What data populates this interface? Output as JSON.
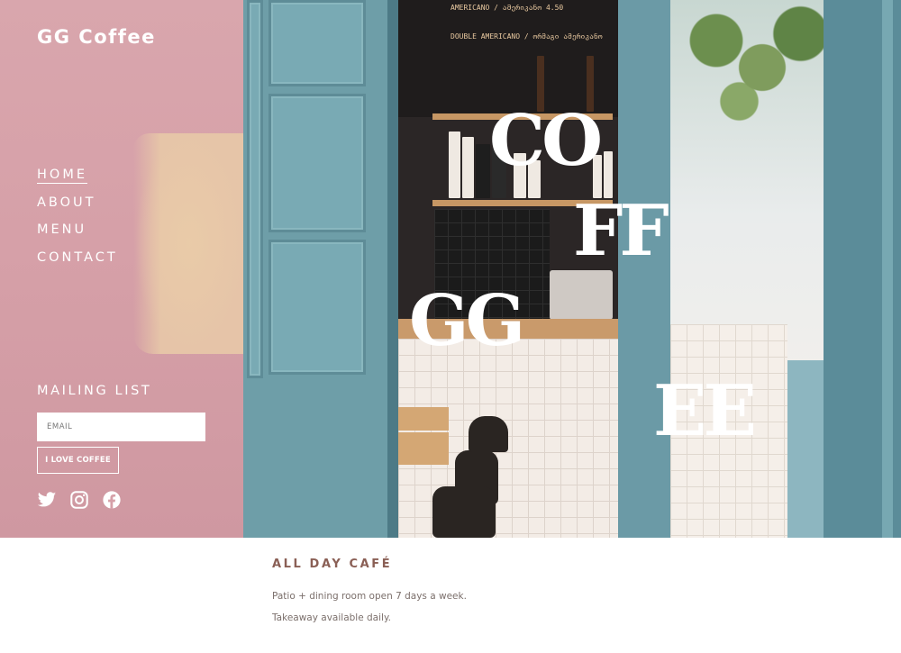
{
  "site": {
    "brand": "GG Coffee"
  },
  "nav": {
    "items": [
      {
        "label": "HOME",
        "active": true
      },
      {
        "label": "ABOUT",
        "active": false
      },
      {
        "label": "MENU",
        "active": false
      },
      {
        "label": "CONTACT",
        "active": false
      }
    ]
  },
  "mailing": {
    "title": "MAILING LIST",
    "email_placeholder": "EMAIL",
    "email_value": "",
    "submit_label": "I LOVE COFFEE"
  },
  "social": {
    "icons": [
      "twitter-icon",
      "instagram-icon",
      "facebook-icon"
    ]
  },
  "hero": {
    "chalkboard_line1": "AMERICANO / ამერიკანო 4.50",
    "chalkboard_line2": "DOUBLE AMERICANO / ორმაგი ამერიკანო",
    "letters": [
      "CO",
      "FF",
      "GG",
      "EE"
    ]
  },
  "content": {
    "title": "ALL DAY CAFÉ",
    "line1": "Patio + dining room open 7 days a week.",
    "line2": "Takeaway available daily."
  },
  "colors": {
    "sidebar_pink": "#d6a0a8",
    "sidebar_beige": "#e9cba8",
    "title_brown": "#8a5f55",
    "body_text": "#7b6f6b",
    "door_teal": "#6e9ea8"
  }
}
